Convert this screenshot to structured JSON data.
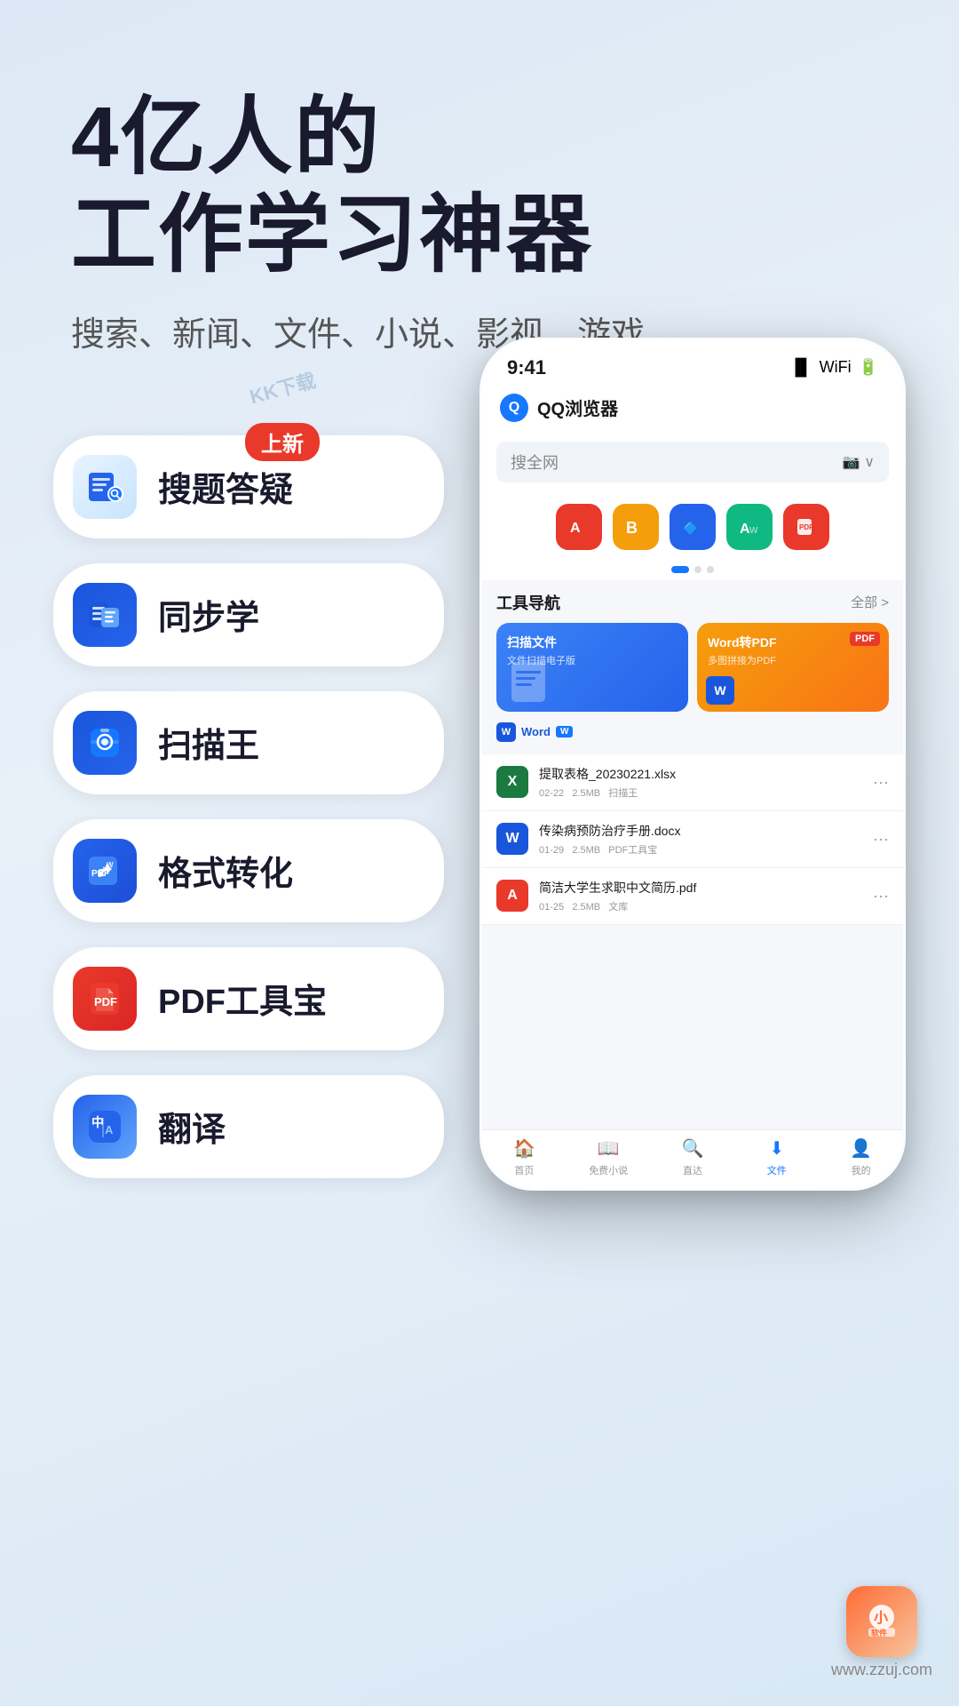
{
  "hero": {
    "title_line1": "4亿人的",
    "title_line2": "工作学习神器",
    "subtitle": "搜索、新闻、文件、小说、影视、游戏"
  },
  "features": [
    {
      "id": "search-qa",
      "label": "搜题答疑",
      "icon_class": "icon-search-qa",
      "badge": "上新",
      "show_badge": true
    },
    {
      "id": "sync-learn",
      "label": "同步学",
      "icon_class": "icon-sync",
      "show_badge": false
    },
    {
      "id": "scan",
      "label": "扫描王",
      "icon_class": "icon-scan",
      "show_badge": false
    },
    {
      "id": "convert",
      "label": "格式转化",
      "icon_class": "icon-convert",
      "show_badge": false
    },
    {
      "id": "pdf",
      "label": "PDF工具宝",
      "icon_class": "icon-pdf",
      "show_badge": false
    },
    {
      "id": "translate",
      "label": "翻译",
      "icon_class": "icon-translate",
      "show_badge": false
    }
  ],
  "phone": {
    "status_bar": {
      "time": "9:41"
    },
    "app_name": "QQ浏览器",
    "search_placeholder": "搜全网",
    "tools_section_title": "工具导航",
    "tools_more_label": "全部 >",
    "tool_cards": [
      {
        "id": "scan-file",
        "title": "扫描文件",
        "subtitle": "文件扫描电子版",
        "color": "blue"
      },
      {
        "id": "word-pdf",
        "title": "Word转PDF",
        "subtitle": "多图拼接为PDF",
        "color": "orange"
      }
    ],
    "files": [
      {
        "id": "file1",
        "type": "xlsx",
        "name": "提取表格_20230221.xlsx",
        "date": "02-22",
        "size": "2.5MB",
        "source": "扫描王"
      },
      {
        "id": "file2",
        "type": "docx",
        "name": "传染病预防治疗手册.docx",
        "date": "01-29",
        "size": "2.5MB",
        "source": "PDF工具宝"
      },
      {
        "id": "file3",
        "type": "pdf",
        "name": "简洁大学生求职中文简历.pdf",
        "date": "01-25",
        "size": "2.5MB",
        "source": "文库"
      }
    ],
    "bottom_nav": [
      {
        "id": "home",
        "label": "首页",
        "active": false
      },
      {
        "id": "novels",
        "label": "免费小说",
        "active": false
      },
      {
        "id": "zhida",
        "label": "直达",
        "active": false
      },
      {
        "id": "files",
        "label": "文件",
        "active": true
      },
      {
        "id": "profile",
        "label": "我的",
        "active": false
      }
    ]
  },
  "watermark": "KK下载",
  "brand": {
    "url": "www.zzuj.com"
  },
  "badge_new": "上新"
}
